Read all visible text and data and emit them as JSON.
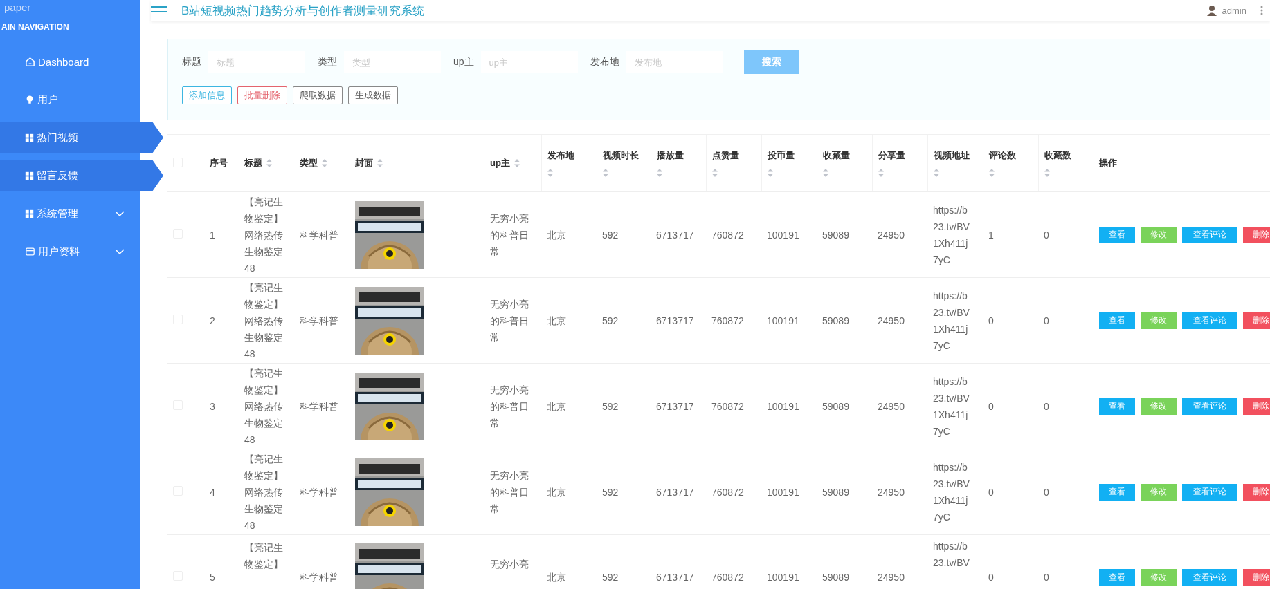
{
  "logo": "paper",
  "header": {
    "title": "B站短视频热门趋势分析与创作者测量研究系统",
    "user": "admin"
  },
  "sidebar": {
    "heading": "AIN NAVIGATION",
    "items": [
      {
        "label": "Dashboard",
        "highlighted": false,
        "expandable": false
      },
      {
        "label": "用户",
        "highlighted": false,
        "expandable": false
      },
      {
        "label": "热门视频",
        "highlighted": true,
        "expandable": false
      },
      {
        "label": "留言反馈",
        "highlighted": true,
        "expandable": false
      },
      {
        "label": "系统管理",
        "highlighted": false,
        "expandable": true
      },
      {
        "label": "用户资料",
        "highlighted": false,
        "expandable": true
      }
    ]
  },
  "search": {
    "fields": [
      {
        "label": "标题",
        "placeholder": "标题"
      },
      {
        "label": "类型",
        "placeholder": "类型"
      },
      {
        "label": "up主",
        "placeholder": "up主"
      },
      {
        "label": "发布地",
        "placeholder": "发布地"
      }
    ],
    "button": "搜索"
  },
  "actions": [
    {
      "label": "添加信息",
      "kind": "add"
    },
    {
      "label": "批量删除",
      "kind": "delete"
    },
    {
      "label": "爬取数据",
      "kind": "plain"
    },
    {
      "label": "生成数据",
      "kind": "plain"
    }
  ],
  "table": {
    "select_all_checked": false,
    "columns": [
      {
        "label": "序号",
        "sortable": false
      },
      {
        "label": "标题",
        "sortable": true
      },
      {
        "label": "类型",
        "sortable": true
      },
      {
        "label": "封面",
        "sortable": true
      },
      {
        "label": "up主",
        "sortable": true
      },
      {
        "label": "发布地",
        "sortable": true
      },
      {
        "label": "视频时长",
        "sortable": true
      },
      {
        "label": "播放量",
        "sortable": true
      },
      {
        "label": "点赞量",
        "sortable": true
      },
      {
        "label": "投币量",
        "sortable": true
      },
      {
        "label": "收藏量",
        "sortable": true
      },
      {
        "label": "分享量",
        "sortable": true
      },
      {
        "label": "视频地址",
        "sortable": true
      },
      {
        "label": "评论数",
        "sortable": true
      },
      {
        "label": "收藏数",
        "sortable": true
      },
      {
        "label": "操作",
        "sortable": false
      }
    ],
    "rows": [
      {
        "checked": false,
        "index": "1",
        "title": "【亮记生物鉴定】网络热传生物鉴定48",
        "type": "科学科普",
        "cover": {
          "kind": "picture"
        },
        "uploader": "无穷小亮的科普日常",
        "location": "北京",
        "duration": "592",
        "plays": "6713717",
        "likes": "760872",
        "coins": "100191",
        "favorites": "59089",
        "shares": "24950",
        "url": "https://b23.tv/BV1Xh411j7yC",
        "comments": "1",
        "collections": "0",
        "buttons": [
          {
            "label": "查看",
            "kind": "view"
          },
          {
            "label": "修改",
            "kind": "edit"
          },
          {
            "label": "查看评论",
            "kind": "view"
          },
          {
            "label": "删除",
            "kind": "delete"
          }
        ]
      },
      {
        "checked": false,
        "index": "2",
        "title": "【亮记生物鉴定】网络热传生物鉴定48",
        "type": "科学科普",
        "cover": {
          "kind": "picture"
        },
        "uploader": "无穷小亮的科普日常",
        "location": "北京",
        "duration": "592",
        "plays": "6713717",
        "likes": "760872",
        "coins": "100191",
        "favorites": "59089",
        "shares": "24950",
        "url": "https://b23.tv/BV1Xh411j7yC",
        "comments": "0",
        "collections": "0",
        "buttons": [
          {
            "label": "查看",
            "kind": "view"
          },
          {
            "label": "修改",
            "kind": "edit"
          },
          {
            "label": "查看评论",
            "kind": "view"
          },
          {
            "label": "删除",
            "kind": "delete"
          }
        ]
      },
      {
        "checked": false,
        "index": "3",
        "title": "【亮记生物鉴定】网络热传生物鉴定48",
        "type": "科学科普",
        "cover": {
          "kind": "picture"
        },
        "uploader": "无穷小亮的科普日常",
        "location": "北京",
        "duration": "592",
        "plays": "6713717",
        "likes": "760872",
        "coins": "100191",
        "favorites": "59089",
        "shares": "24950",
        "url": "https://b23.tv/BV1Xh411j7yC",
        "comments": "0",
        "collections": "0",
        "buttons": [
          {
            "label": "查看",
            "kind": "view"
          },
          {
            "label": "修改",
            "kind": "edit"
          },
          {
            "label": "查看评论",
            "kind": "view"
          },
          {
            "label": "删除",
            "kind": "delete"
          }
        ]
      },
      {
        "checked": false,
        "index": "4",
        "title": "【亮记生物鉴定】网络热传生物鉴定48",
        "type": "科学科普",
        "cover": {
          "kind": "picture"
        },
        "uploader": "无穷小亮的科普日常",
        "location": "北京",
        "duration": "592",
        "plays": "6713717",
        "likes": "760872",
        "coins": "100191",
        "favorites": "59089",
        "shares": "24950",
        "url": "https://b23.tv/BV1Xh411j7yC",
        "comments": "0",
        "collections": "0",
        "buttons": [
          {
            "label": "查看",
            "kind": "view"
          },
          {
            "label": "修改",
            "kind": "edit"
          },
          {
            "label": "查看评论",
            "kind": "view"
          },
          {
            "label": "删除",
            "kind": "delete"
          }
        ]
      },
      {
        "checked": false,
        "index": "5",
        "title": "【亮记生物鉴定】",
        "type": "科学科普",
        "cover": {
          "kind": "picture"
        },
        "uploader": "无穷小亮",
        "location": "北京",
        "duration": "592",
        "plays": "6713717",
        "likes": "760872",
        "coins": "100191",
        "favorites": "59089",
        "shares": "24950",
        "url": "https://b23.tv/BV",
        "comments": "0",
        "collections": "0",
        "buttons": [
          {
            "label": "查看",
            "kind": "view"
          },
          {
            "label": "修改",
            "kind": "edit"
          },
          {
            "label": "查看评论",
            "kind": "view"
          },
          {
            "label": "删除",
            "kind": "delete"
          }
        ]
      }
    ]
  }
}
